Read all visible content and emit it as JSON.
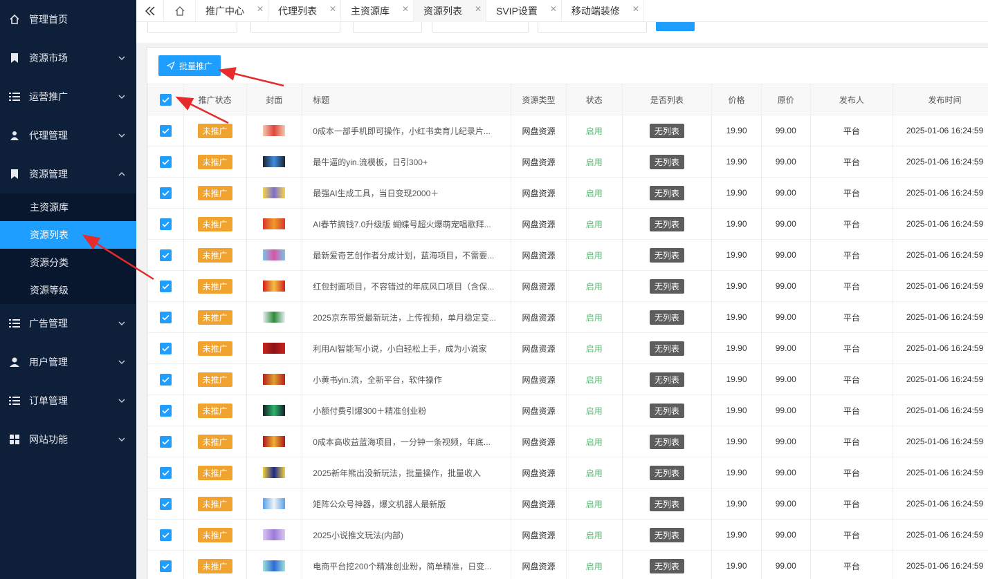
{
  "sidebar": {
    "items": [
      {
        "label": "管理首页",
        "icon": "home-icon",
        "expanded": null
      },
      {
        "label": "资源市场",
        "icon": "bookmark-icon",
        "expanded": false
      },
      {
        "label": "运营推广",
        "icon": "list-icon",
        "expanded": false
      },
      {
        "label": "代理管理",
        "icon": "users-icon",
        "expanded": false
      },
      {
        "label": "资源管理",
        "icon": "bookmark-icon",
        "expanded": true
      },
      {
        "label": "广告管理",
        "icon": "list-icon",
        "expanded": false
      },
      {
        "label": "用户管理",
        "icon": "user-icon",
        "expanded": false
      },
      {
        "label": "订单管理",
        "icon": "list-icon",
        "expanded": false
      },
      {
        "label": "网站功能",
        "icon": "apps-icon",
        "expanded": false
      }
    ],
    "submenu": [
      {
        "label": "主资源库",
        "active": false
      },
      {
        "label": "资源列表",
        "active": true
      },
      {
        "label": "资源分类",
        "active": false
      },
      {
        "label": "资源等级",
        "active": false
      }
    ]
  },
  "tabs": [
    {
      "label": "推广中心",
      "active": false
    },
    {
      "label": "代理列表",
      "active": false
    },
    {
      "label": "主资源库",
      "active": false
    },
    {
      "label": "资源列表",
      "active": true
    },
    {
      "label": "SVIP设置",
      "active": false
    },
    {
      "label": "移动端装修",
      "active": false
    }
  ],
  "toolbar": {
    "batch_label": "批量推广"
  },
  "table": {
    "headers": {
      "promo_status": "推广状态",
      "cover": "封面",
      "title": "标题",
      "type": "资源类型",
      "status": "状态",
      "listed": "是否列表",
      "price": "价格",
      "original": "原价",
      "publisher": "发布人",
      "time": "发布时间"
    },
    "rows": [
      {
        "checked": true,
        "promo": "未推广",
        "thumb": [
          "#f2c9b0",
          "#e2463c"
        ],
        "title": "0成本一部手机即可操作，小红书卖育儿纪录片...",
        "type": "网盘资源",
        "status": "启用",
        "listed": "无列表",
        "price": "19.90",
        "original": "99.00",
        "publisher": "平台",
        "time": "2025-01-06 16:24:59"
      },
      {
        "checked": true,
        "promo": "未推广",
        "thumb": [
          "#1b2430",
          "#3c8ce0"
        ],
        "title": "最牛逼的yin.流模板，日引300+",
        "type": "网盘资源",
        "status": "启用",
        "listed": "无列表",
        "price": "19.90",
        "original": "99.00",
        "publisher": "平台",
        "time": "2025-01-06 16:24:59"
      },
      {
        "checked": true,
        "promo": "未推广",
        "thumb": [
          "#f4d54a",
          "#7a6fd0"
        ],
        "title": "最强AI生成工具，当日变现2000＋",
        "type": "网盘资源",
        "status": "启用",
        "listed": "无列表",
        "price": "19.90",
        "original": "99.00",
        "publisher": "平台",
        "time": "2025-01-06 16:24:59"
      },
      {
        "checked": true,
        "promo": "未推广",
        "thumb": [
          "#d8362c",
          "#f09a2a"
        ],
        "title": "AI春节搞钱7.0升级版 蝴蝶号超火爆萌宠唱歌拜...",
        "type": "网盘资源",
        "status": "启用",
        "listed": "无列表",
        "price": "19.90",
        "original": "99.00",
        "publisher": "平台",
        "time": "2025-01-06 16:24:59"
      },
      {
        "checked": true,
        "promo": "未推广",
        "thumb": [
          "#7bc3e8",
          "#d855a5"
        ],
        "title": "最新爱奇艺创作者分成计划，蓝海项目，不需要...",
        "type": "网盘资源",
        "status": "启用",
        "listed": "无列表",
        "price": "19.90",
        "original": "99.00",
        "publisher": "平台",
        "time": "2025-01-06 16:24:59"
      },
      {
        "checked": true,
        "promo": "未推广",
        "thumb": [
          "#d41f1f",
          "#f0c040"
        ],
        "title": "红包封面项目，不容错过的年底风口项目（含保...",
        "type": "网盘资源",
        "status": "启用",
        "listed": "无列表",
        "price": "19.90",
        "original": "99.00",
        "publisher": "平台",
        "time": "2025-01-06 16:24:59"
      },
      {
        "checked": true,
        "promo": "未推广",
        "thumb": [
          "#e9eef2",
          "#2f8a3a"
        ],
        "title": "2025京东带货最新玩法，上传视频，单月稳定变...",
        "type": "网盘资源",
        "status": "启用",
        "listed": "无列表",
        "price": "19.90",
        "original": "99.00",
        "publisher": "平台",
        "time": "2025-01-06 16:24:59"
      },
      {
        "checked": true,
        "promo": "未推广",
        "thumb": [
          "#c8231f",
          "#8a1414"
        ],
        "title": "利用AI智能写小说，小白轻松上手，成为小说家",
        "type": "网盘资源",
        "status": "启用",
        "listed": "无列表",
        "price": "19.90",
        "original": "99.00",
        "publisher": "平台",
        "time": "2025-01-06 16:24:59"
      },
      {
        "checked": true,
        "promo": "未推广",
        "thumb": [
          "#b4201a",
          "#e0a030"
        ],
        "title": "小黄书yin.流，全新平台，软件操作",
        "type": "网盘资源",
        "status": "启用",
        "listed": "无列表",
        "price": "19.90",
        "original": "99.00",
        "publisher": "平台",
        "time": "2025-01-06 16:24:59"
      },
      {
        "checked": true,
        "promo": "未推广",
        "thumb": [
          "#10202a",
          "#2fb46a"
        ],
        "title": "小额付费引爆300＋精准创业粉",
        "type": "网盘资源",
        "status": "启用",
        "listed": "无列表",
        "price": "19.90",
        "original": "99.00",
        "publisher": "平台",
        "time": "2025-01-06 16:24:59"
      },
      {
        "checked": true,
        "promo": "未推广",
        "thumb": [
          "#a8171a",
          "#f0b030"
        ],
        "title": "0成本高收益蓝海项目，一分钟一条视频，年底...",
        "type": "网盘资源",
        "status": "启用",
        "listed": "无列表",
        "price": "19.90",
        "original": "99.00",
        "publisher": "平台",
        "time": "2025-01-06 16:24:59"
      },
      {
        "checked": true,
        "promo": "未推广",
        "thumb": [
          "#f4d23a",
          "#1a2a8a"
        ],
        "title": "2025新年熊出没新玩法，批量操作，批量收入",
        "type": "网盘资源",
        "status": "启用",
        "listed": "无列表",
        "price": "19.90",
        "original": "99.00",
        "publisher": "平台",
        "time": "2025-01-06 16:24:59"
      },
      {
        "checked": true,
        "promo": "未推广",
        "thumb": [
          "#5aa0e8",
          "#f0f4f8"
        ],
        "title": "矩阵公众号神器，爆文机器人最新版",
        "type": "网盘资源",
        "status": "启用",
        "listed": "无列表",
        "price": "19.90",
        "original": "99.00",
        "publisher": "平台",
        "time": "2025-01-06 16:24:59"
      },
      {
        "checked": true,
        "promo": "未推广",
        "thumb": [
          "#d9c8f0",
          "#9b7ad8"
        ],
        "title": "2025小说推文玩法(内部)",
        "type": "网盘资源",
        "status": "启用",
        "listed": "无列表",
        "price": "19.90",
        "original": "99.00",
        "publisher": "平台",
        "time": "2025-01-06 16:24:59"
      },
      {
        "checked": true,
        "promo": "未推广",
        "thumb": [
          "#9fe0d8",
          "#2a6ad8"
        ],
        "title": "电商平台挖200个精准创业粉，简单精准，日变...",
        "type": "网盘资源",
        "status": "启用",
        "listed": "无列表",
        "price": "19.90",
        "original": "99.00",
        "publisher": "平台",
        "time": "2025-01-06 16:24:59"
      }
    ]
  },
  "colors": {
    "sidebar_bg": "#0e1f3a",
    "accent": "#1e9fff",
    "badge_orange": "#f0a32e",
    "badge_dark": "#5d5d5d",
    "status_on": "#5fb878",
    "annotation_red": "#e52b2b"
  }
}
